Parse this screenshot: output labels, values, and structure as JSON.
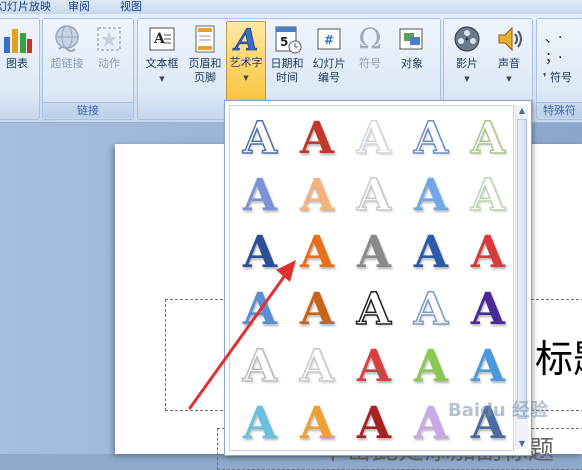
{
  "tabs": [
    "幻灯片放映",
    "审阅",
    "视图"
  ],
  "ribbon": {
    "chart": {
      "label": "图表"
    },
    "links_group": {
      "label": "链接",
      "hyperlink": "超链接",
      "action": "动作"
    },
    "text_group": {
      "textbox": "文本框",
      "header_footer_1": "页眉和",
      "header_footer_2": "页脚",
      "wordart": "艺术字",
      "datetime_1": "日期和",
      "datetime_2": "时间",
      "slide_number_1": "幻灯片",
      "slide_number_2": "编号",
      "symbol": "符号",
      "object": "对象"
    },
    "media_group": {
      "movie": "影片",
      "sound": "声音"
    },
    "special_group": {
      "label": "特殊符",
      "symbol_item": "符号"
    }
  },
  "slide": {
    "title_text": "标题",
    "subtitle_text": "单击此处添加副标题"
  },
  "wordart_gallery": {
    "rows": [
      [
        {
          "color": "#4f6fa8",
          "style": "outline"
        },
        {
          "color": "#c0392b",
          "style": "fill"
        },
        {
          "color": "#cfd6de",
          "style": "outline"
        },
        {
          "color": "#6b8cc0",
          "style": "outline"
        },
        {
          "color": "#a9c48a",
          "style": "outline"
        }
      ],
      [
        {
          "color": "#7b93d6",
          "style": "fill"
        },
        {
          "color": "#f5b27a",
          "style": "fill"
        },
        {
          "color": "#c8c8c8",
          "style": "outline"
        },
        {
          "color": "#6fa8e8",
          "style": "fill"
        },
        {
          "color": "#b8d4ae",
          "style": "outline"
        }
      ],
      [
        {
          "color": "#2c4f9a",
          "style": "fill"
        },
        {
          "color": "#e8701a",
          "style": "fill"
        },
        {
          "color": "#8a8a8a",
          "style": "fill"
        },
        {
          "color": "#2a5aa8",
          "style": "fill"
        },
        {
          "color": "#d63a3a",
          "style": "fill"
        }
      ],
      [
        {
          "color": "#5a8ed6",
          "style": "fill"
        },
        {
          "color": "#c8641a",
          "style": "fill"
        },
        {
          "color": "#222222",
          "style": "outline"
        },
        {
          "color": "#7a9ac0",
          "style": "outline"
        },
        {
          "color": "#4a2a9a",
          "style": "fill"
        }
      ],
      [
        {
          "color": "#bbbbbb",
          "style": "outline"
        },
        {
          "color": "#c8c8c8",
          "style": "outline"
        },
        {
          "color": "#d84040",
          "style": "fill"
        },
        {
          "color": "#8ac850",
          "style": "fill"
        },
        {
          "color": "#4a9ae0",
          "style": "fill"
        }
      ],
      [
        {
          "color": "#6ac0e0",
          "style": "fill"
        },
        {
          "color": "#f0a030",
          "style": "fill"
        },
        {
          "color": "#a82020",
          "style": "fill"
        },
        {
          "color": "#c8a8e8",
          "style": "fill"
        },
        {
          "color": "#4a6aa0",
          "style": "fill"
        }
      ]
    ]
  },
  "watermark": "Baidu 经验",
  "colors": {
    "ribbon_bg": "#d6e3f3",
    "active_button": "#fbd56a",
    "annotation_arrow": "#e03030"
  },
  "icons": {
    "chart": "bar-chart-icon",
    "hyperlink": "globe-link-icon",
    "action": "star-action-icon",
    "textbox": "textbox-icon",
    "header_footer": "header-footer-icon",
    "wordart": "wordart-a-icon",
    "datetime": "calendar-icon",
    "slide_number": "slide-number-icon",
    "symbol": "omega-icon",
    "object": "object-icon",
    "movie": "film-reel-icon",
    "sound": "speaker-icon"
  }
}
